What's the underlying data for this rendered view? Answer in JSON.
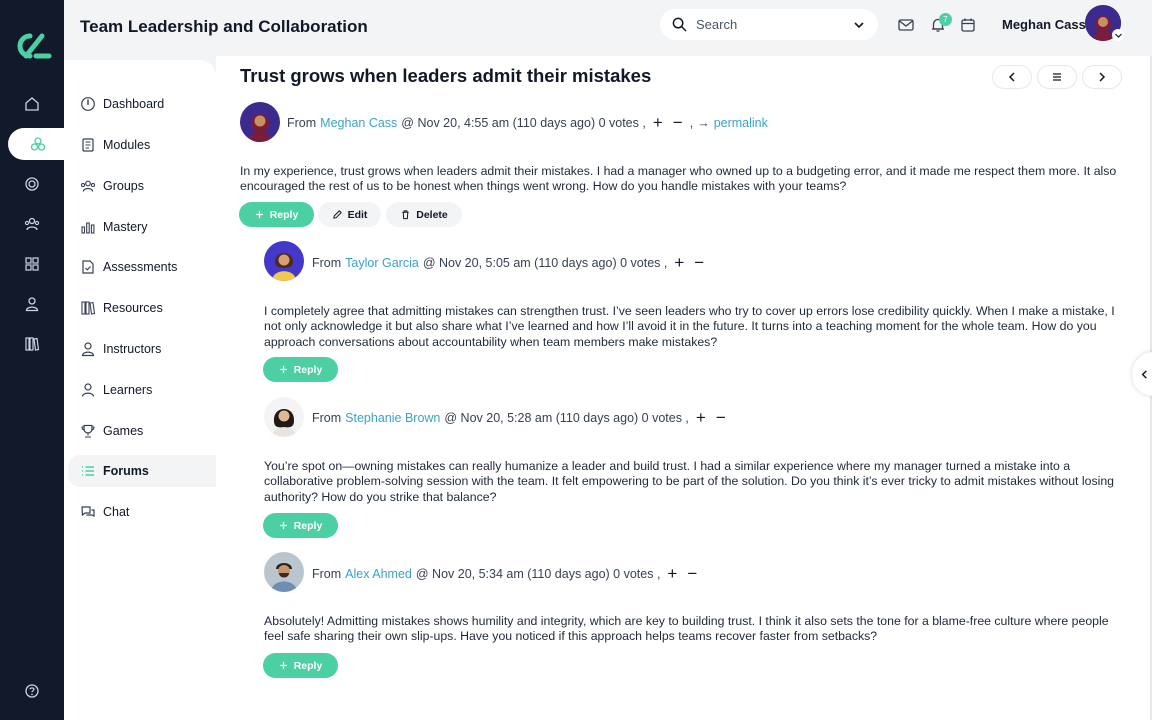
{
  "header": {
    "title": "Team Leadership and Collaboration",
    "search_placeholder": "Search",
    "notification_count": "7",
    "user_name": "Meghan Cass"
  },
  "rail": {
    "icons": [
      "home-icon",
      "modules-icon",
      "target-icon",
      "users-icon",
      "grid-icon",
      "user-icon",
      "library-icon",
      "help-icon"
    ]
  },
  "nav": {
    "items": [
      {
        "label": "Dashboard",
        "icon": "dashboard-icon"
      },
      {
        "label": "Modules",
        "icon": "modules-icon"
      },
      {
        "label": "Groups",
        "icon": "groups-icon"
      },
      {
        "label": "Mastery",
        "icon": "mastery-icon"
      },
      {
        "label": "Assessments",
        "icon": "assessments-icon"
      },
      {
        "label": "Resources",
        "icon": "resources-icon"
      },
      {
        "label": "Instructors",
        "icon": "instructors-icon"
      },
      {
        "label": "Learners",
        "icon": "learners-icon"
      },
      {
        "label": "Games",
        "icon": "games-icon"
      },
      {
        "label": "Forums",
        "icon": "forums-icon"
      },
      {
        "label": "Chat",
        "icon": "chat-icon"
      }
    ],
    "active": "Forums"
  },
  "thread": {
    "title": "Trust grows when leaders admit their mistakes",
    "post": {
      "from_label": "From",
      "author": "Meghan Cass",
      "meta": "@ Nov 20, 4:55 am (110 days ago) 0 votes ,",
      "plus": "+",
      "minus": "−",
      "sep": ",",
      "arrow": "→",
      "permalink": "permalink",
      "body": "In my experience, trust grows when leaders admit their mistakes. I had a manager who owned up to a budgeting error, and it made me respect them more. It also encouraged the rest of us to be honest when things went wrong. How do you handle mistakes with your teams?",
      "reply_label": "Reply",
      "edit_label": "Edit",
      "delete_label": "Delete"
    },
    "replies": [
      {
        "from_label": "From",
        "author": "Taylor Garcia",
        "meta": "@ Nov 20, 5:05 am (110 days ago) 0 votes ,",
        "plus": "+",
        "minus": "−",
        "body": "I completely agree that admitting mistakes can strengthen trust. I’ve seen leaders who try to cover up errors lose credibility quickly. When I make a mistake, I not only acknowledge it but also share what I’ve learned and how I’ll avoid it in the future. It turns into a teaching moment for the whole team. How do you approach conversations about accountability when team members make mistakes?",
        "reply_label": "Reply"
      },
      {
        "from_label": "From",
        "author": "Stephanie Brown",
        "meta": "@ Nov 20, 5:28 am (110 days ago) 0 votes ,",
        "plus": "+",
        "minus": "−",
        "body": "You’re spot on—owning mistakes can really humanize a leader and build trust. I had a similar experience where my manager turned a mistake into a collaborative problem-solving session with the team. It felt empowering to be part of the solution. Do you think it’s ever tricky to admit mistakes without losing authority? How do you strike that balance?",
        "reply_label": "Reply"
      },
      {
        "from_label": "From",
        "author": "Alex Ahmed",
        "meta": "@ Nov 20, 5:34 am (110 days ago) 0 votes ,",
        "plus": "+",
        "minus": "−",
        "body": "Absolutely! Admitting mistakes shows humility and integrity, which are key to building trust. I think it also sets the tone for a blame-free culture where people feel safe sharing their own slip-ups. Have you noticed if this approach helps teams recover faster from setbacks?",
        "reply_label": "Reply"
      }
    ]
  },
  "colors": {
    "rail_bg": "#12192b",
    "accent": "#4ccfa3",
    "link": "#3aa3c8",
    "surface": "#f3f4f6"
  }
}
